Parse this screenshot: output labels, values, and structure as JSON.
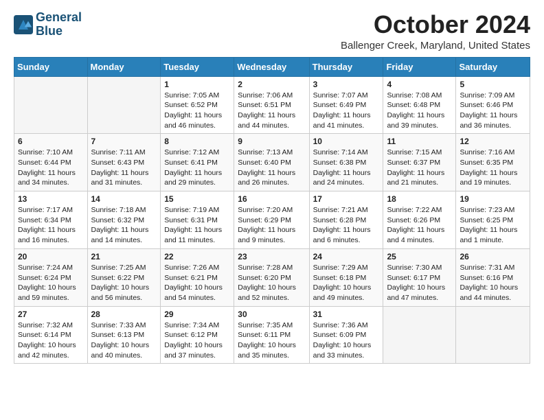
{
  "logo": {
    "line1": "General",
    "line2": "Blue"
  },
  "title": "October 2024",
  "location": "Ballenger Creek, Maryland, United States",
  "weekdays": [
    "Sunday",
    "Monday",
    "Tuesday",
    "Wednesday",
    "Thursday",
    "Friday",
    "Saturday"
  ],
  "weeks": [
    [
      {
        "day": "",
        "sunrise": "",
        "sunset": "",
        "daylight": ""
      },
      {
        "day": "",
        "sunrise": "",
        "sunset": "",
        "daylight": ""
      },
      {
        "day": "1",
        "sunrise": "Sunrise: 7:05 AM",
        "sunset": "Sunset: 6:52 PM",
        "daylight": "Daylight: 11 hours and 46 minutes."
      },
      {
        "day": "2",
        "sunrise": "Sunrise: 7:06 AM",
        "sunset": "Sunset: 6:51 PM",
        "daylight": "Daylight: 11 hours and 44 minutes."
      },
      {
        "day": "3",
        "sunrise": "Sunrise: 7:07 AM",
        "sunset": "Sunset: 6:49 PM",
        "daylight": "Daylight: 11 hours and 41 minutes."
      },
      {
        "day": "4",
        "sunrise": "Sunrise: 7:08 AM",
        "sunset": "Sunset: 6:48 PM",
        "daylight": "Daylight: 11 hours and 39 minutes."
      },
      {
        "day": "5",
        "sunrise": "Sunrise: 7:09 AM",
        "sunset": "Sunset: 6:46 PM",
        "daylight": "Daylight: 11 hours and 36 minutes."
      }
    ],
    [
      {
        "day": "6",
        "sunrise": "Sunrise: 7:10 AM",
        "sunset": "Sunset: 6:44 PM",
        "daylight": "Daylight: 11 hours and 34 minutes."
      },
      {
        "day": "7",
        "sunrise": "Sunrise: 7:11 AM",
        "sunset": "Sunset: 6:43 PM",
        "daylight": "Daylight: 11 hours and 31 minutes."
      },
      {
        "day": "8",
        "sunrise": "Sunrise: 7:12 AM",
        "sunset": "Sunset: 6:41 PM",
        "daylight": "Daylight: 11 hours and 29 minutes."
      },
      {
        "day": "9",
        "sunrise": "Sunrise: 7:13 AM",
        "sunset": "Sunset: 6:40 PM",
        "daylight": "Daylight: 11 hours and 26 minutes."
      },
      {
        "day": "10",
        "sunrise": "Sunrise: 7:14 AM",
        "sunset": "Sunset: 6:38 PM",
        "daylight": "Daylight: 11 hours and 24 minutes."
      },
      {
        "day": "11",
        "sunrise": "Sunrise: 7:15 AM",
        "sunset": "Sunset: 6:37 PM",
        "daylight": "Daylight: 11 hours and 21 minutes."
      },
      {
        "day": "12",
        "sunrise": "Sunrise: 7:16 AM",
        "sunset": "Sunset: 6:35 PM",
        "daylight": "Daylight: 11 hours and 19 minutes."
      }
    ],
    [
      {
        "day": "13",
        "sunrise": "Sunrise: 7:17 AM",
        "sunset": "Sunset: 6:34 PM",
        "daylight": "Daylight: 11 hours and 16 minutes."
      },
      {
        "day": "14",
        "sunrise": "Sunrise: 7:18 AM",
        "sunset": "Sunset: 6:32 PM",
        "daylight": "Daylight: 11 hours and 14 minutes."
      },
      {
        "day": "15",
        "sunrise": "Sunrise: 7:19 AM",
        "sunset": "Sunset: 6:31 PM",
        "daylight": "Daylight: 11 hours and 11 minutes."
      },
      {
        "day": "16",
        "sunrise": "Sunrise: 7:20 AM",
        "sunset": "Sunset: 6:29 PM",
        "daylight": "Daylight: 11 hours and 9 minutes."
      },
      {
        "day": "17",
        "sunrise": "Sunrise: 7:21 AM",
        "sunset": "Sunset: 6:28 PM",
        "daylight": "Daylight: 11 hours and 6 minutes."
      },
      {
        "day": "18",
        "sunrise": "Sunrise: 7:22 AM",
        "sunset": "Sunset: 6:26 PM",
        "daylight": "Daylight: 11 hours and 4 minutes."
      },
      {
        "day": "19",
        "sunrise": "Sunrise: 7:23 AM",
        "sunset": "Sunset: 6:25 PM",
        "daylight": "Daylight: 11 hours and 1 minute."
      }
    ],
    [
      {
        "day": "20",
        "sunrise": "Sunrise: 7:24 AM",
        "sunset": "Sunset: 6:24 PM",
        "daylight": "Daylight: 10 hours and 59 minutes."
      },
      {
        "day": "21",
        "sunrise": "Sunrise: 7:25 AM",
        "sunset": "Sunset: 6:22 PM",
        "daylight": "Daylight: 10 hours and 56 minutes."
      },
      {
        "day": "22",
        "sunrise": "Sunrise: 7:26 AM",
        "sunset": "Sunset: 6:21 PM",
        "daylight": "Daylight: 10 hours and 54 minutes."
      },
      {
        "day": "23",
        "sunrise": "Sunrise: 7:28 AM",
        "sunset": "Sunset: 6:20 PM",
        "daylight": "Daylight: 10 hours and 52 minutes."
      },
      {
        "day": "24",
        "sunrise": "Sunrise: 7:29 AM",
        "sunset": "Sunset: 6:18 PM",
        "daylight": "Daylight: 10 hours and 49 minutes."
      },
      {
        "day": "25",
        "sunrise": "Sunrise: 7:30 AM",
        "sunset": "Sunset: 6:17 PM",
        "daylight": "Daylight: 10 hours and 47 minutes."
      },
      {
        "day": "26",
        "sunrise": "Sunrise: 7:31 AM",
        "sunset": "Sunset: 6:16 PM",
        "daylight": "Daylight: 10 hours and 44 minutes."
      }
    ],
    [
      {
        "day": "27",
        "sunrise": "Sunrise: 7:32 AM",
        "sunset": "Sunset: 6:14 PM",
        "daylight": "Daylight: 10 hours and 42 minutes."
      },
      {
        "day": "28",
        "sunrise": "Sunrise: 7:33 AM",
        "sunset": "Sunset: 6:13 PM",
        "daylight": "Daylight: 10 hours and 40 minutes."
      },
      {
        "day": "29",
        "sunrise": "Sunrise: 7:34 AM",
        "sunset": "Sunset: 6:12 PM",
        "daylight": "Daylight: 10 hours and 37 minutes."
      },
      {
        "day": "30",
        "sunrise": "Sunrise: 7:35 AM",
        "sunset": "Sunset: 6:11 PM",
        "daylight": "Daylight: 10 hours and 35 minutes."
      },
      {
        "day": "31",
        "sunrise": "Sunrise: 7:36 AM",
        "sunset": "Sunset: 6:09 PM",
        "daylight": "Daylight: 10 hours and 33 minutes."
      },
      {
        "day": "",
        "sunrise": "",
        "sunset": "",
        "daylight": ""
      },
      {
        "day": "",
        "sunrise": "",
        "sunset": "",
        "daylight": ""
      }
    ]
  ]
}
